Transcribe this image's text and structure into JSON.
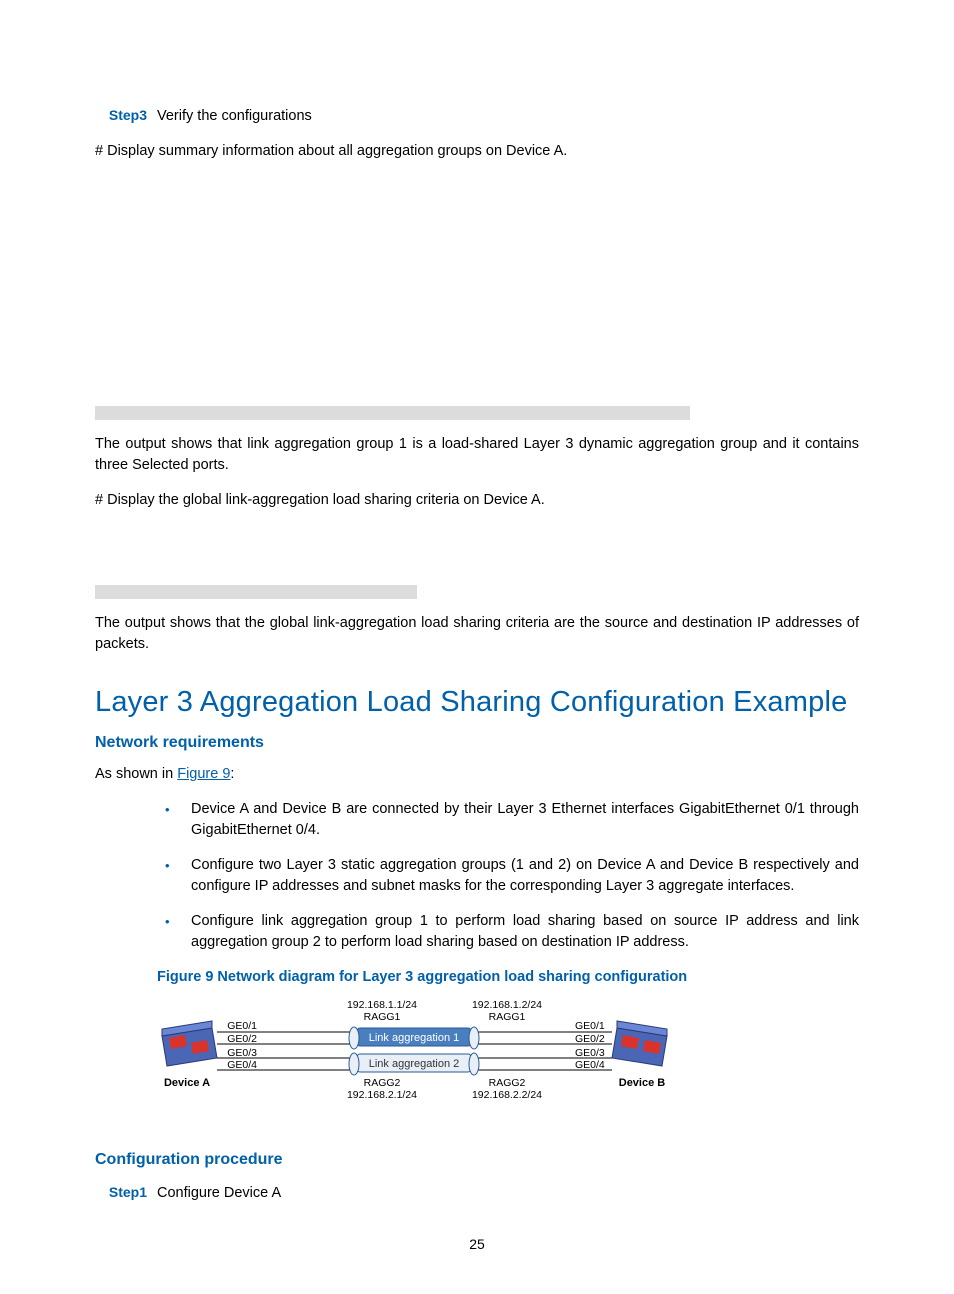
{
  "step3": {
    "label": "Step3",
    "title": "Verify the configurations",
    "line1": "# Display summary information about all aggregation groups on Device A.",
    "outnote1": "The output shows that link aggregation group 1 is a load-shared Layer 3 dynamic aggregation group and it contains three Selected ports.",
    "line2": "# Display the global link-aggregation load sharing criteria on Device A.",
    "outnote2": "The output shows that the global link-aggregation load sharing criteria are the source and destination IP addresses of packets."
  },
  "section": {
    "title": "Layer 3 Aggregation Load Sharing Configuration Example"
  },
  "netreq": {
    "heading": "Network requirements",
    "intro_pre": "As shown in ",
    "intro_link": "Figure 9",
    "intro_post": ":",
    "bullets": [
      "Device A and Device B are connected by their Layer 3 Ethernet interfaces GigabitEthernet 0/1 through GigabitEthernet 0/4.",
      "Configure two Layer 3 static aggregation groups (1 and 2) on Device A and Device B respectively and configure IP addresses and subnet masks for the corresponding Layer 3 aggregate interfaces.",
      "Configure link aggregation group 1 to perform load sharing based on source IP address and link aggregation group 2 to perform load sharing based on destination IP address."
    ]
  },
  "figure": {
    "caption": "Figure 9 Network diagram for Layer 3 aggregation load sharing configuration",
    "left": {
      "device": "Device A",
      "ports": [
        "GE0/1",
        "GE0/2",
        "GE0/3",
        "GE0/4"
      ],
      "top_ip": "192.168.1.1/24",
      "top_ragg": "RAGG1",
      "bot_ragg": "RAGG2",
      "bot_ip": "192.168.2.1/24"
    },
    "right": {
      "device": "Device B",
      "ports": [
        "GE0/1",
        "GE0/2",
        "GE0/3",
        "GE0/4"
      ],
      "top_ip": "192.168.1.2/24",
      "top_ragg": "RAGG1",
      "bot_ragg": "RAGG2",
      "bot_ip": "192.168.2.2/24"
    },
    "agg1": "Link aggregation 1",
    "agg2": "Link aggregation 2"
  },
  "confproc": {
    "heading": "Configuration procedure",
    "step1_label": "Step1",
    "step1_text": "Configure Device A"
  },
  "page_number": "25"
}
